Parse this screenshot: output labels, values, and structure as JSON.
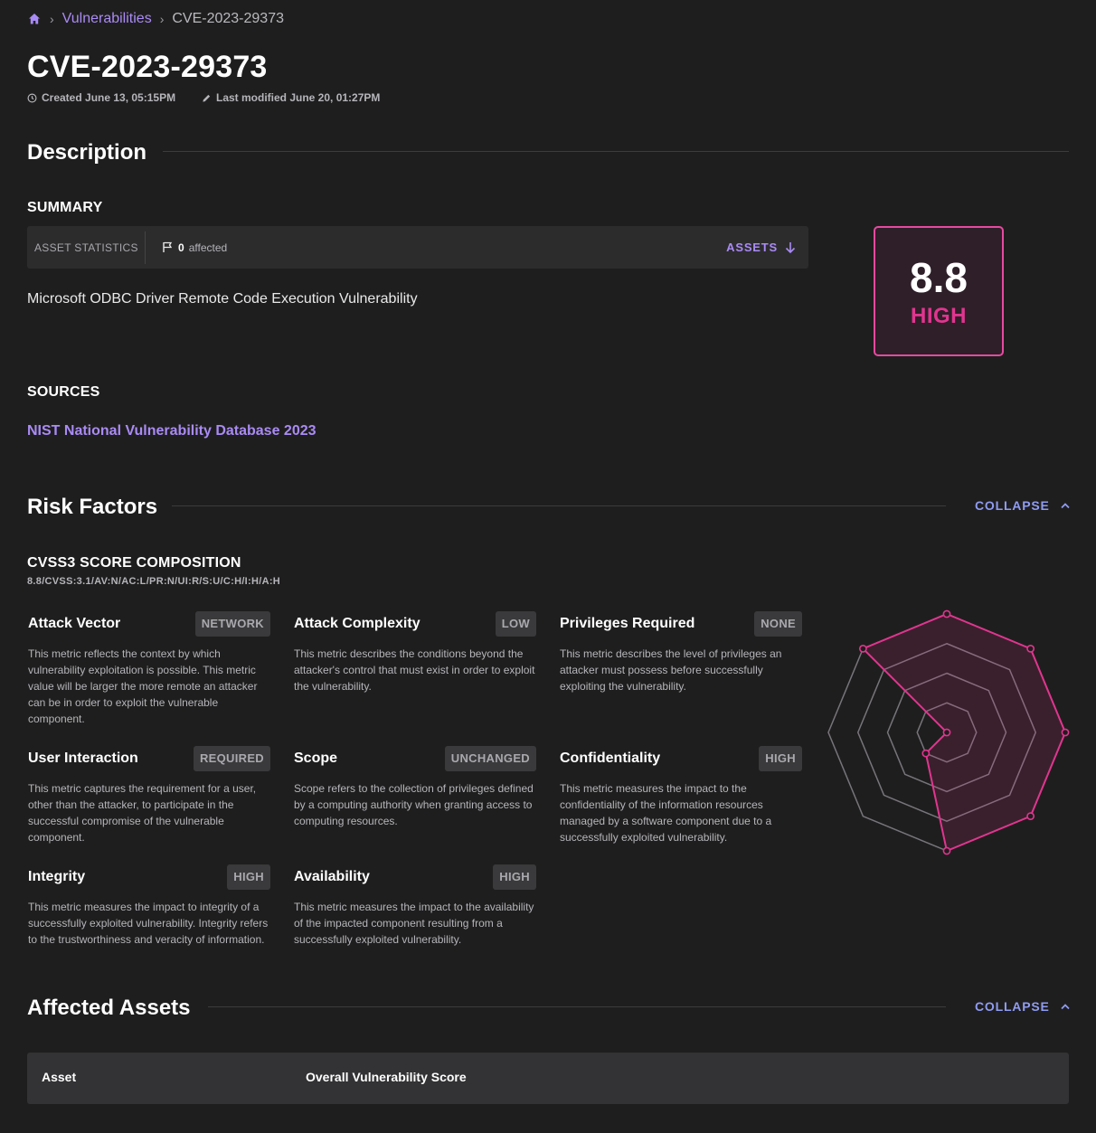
{
  "breadcrumb": {
    "home_icon": "home-icon",
    "items": [
      "Vulnerabilities",
      "CVE-2023-29373"
    ]
  },
  "title": "CVE-2023-29373",
  "meta": {
    "created": "Created June 13, 05:15PM",
    "modified": "Last modified June 20, 01:27PM"
  },
  "description": {
    "title": "Description",
    "summary_heading": "SUMMARY",
    "stats": {
      "label": "ASSET STATISTICS",
      "count": "0",
      "count_suffix": "affected",
      "assets_button": "ASSETS"
    },
    "summary_text": "Microsoft ODBC Driver Remote Code Execution Vulnerability",
    "score": {
      "value": "8.8",
      "label": "HIGH"
    },
    "sources_heading": "SOURCES",
    "source_link": "NIST National Vulnerability Database 2023"
  },
  "risk_factors": {
    "title": "Risk Factors",
    "collapse": "COLLAPSE",
    "composition_heading": "CVSS3 SCORE COMPOSITION",
    "vector": "8.8/CVSS:3.1/AV:N/AC:L/PR:N/UI:R/S:U/C:H/I:H/A:H",
    "metrics": [
      {
        "name": "Attack Vector",
        "value": "NETWORK",
        "desc": "This metric reflects the context by which vulnerability exploitation is possible. This metric value will be larger the more remote an attacker can be in order to exploit the vulnerable component."
      },
      {
        "name": "Attack Complexity",
        "value": "LOW",
        "desc": "This metric describes the conditions beyond the attacker's control that must exist in order to exploit the vulnerability."
      },
      {
        "name": "Privileges Required",
        "value": "NONE",
        "desc": "This metric describes the level of privileges an attacker must possess before successfully exploiting the vulnerability."
      },
      {
        "name": "User Interaction",
        "value": "REQUIRED",
        "desc": "This metric captures the requirement for a user, other than the attacker, to participate in the successful compromise of the vulnerable component."
      },
      {
        "name": "Scope",
        "value": "UNCHANGED",
        "desc": "Scope refers to the collection of privileges defined by a computing authority when granting access to computing resources."
      },
      {
        "name": "Confidentiality",
        "value": "HIGH",
        "desc": "This metric measures the impact to the confidentiality of the information resources managed by a software component due to a successfully exploited vulnerability."
      },
      {
        "name": "Integrity",
        "value": "HIGH",
        "desc": "This metric measures the impact to integrity of a successfully exploited vulnerability. Integrity refers to the trustworthiness and veracity of information."
      },
      {
        "name": "Availability",
        "value": "HIGH",
        "desc": "This metric measures the impact to the availability of the impacted component resulting from a successfully exploited vulnerability."
      }
    ],
    "radar_levels": [
      1,
      1,
      1,
      1,
      1,
      0.25,
      0,
      1
    ],
    "radar_color": "#e0358f"
  },
  "affected_assets": {
    "title": "Affected Assets",
    "collapse": "COLLAPSE",
    "columns": [
      "Asset",
      "Overall Vulnerability Score"
    ]
  },
  "colors": {
    "background": "#1f1e1e",
    "accent": "#a98bf5",
    "collapse": "#8f9cf2",
    "severity": "#e0358f"
  }
}
